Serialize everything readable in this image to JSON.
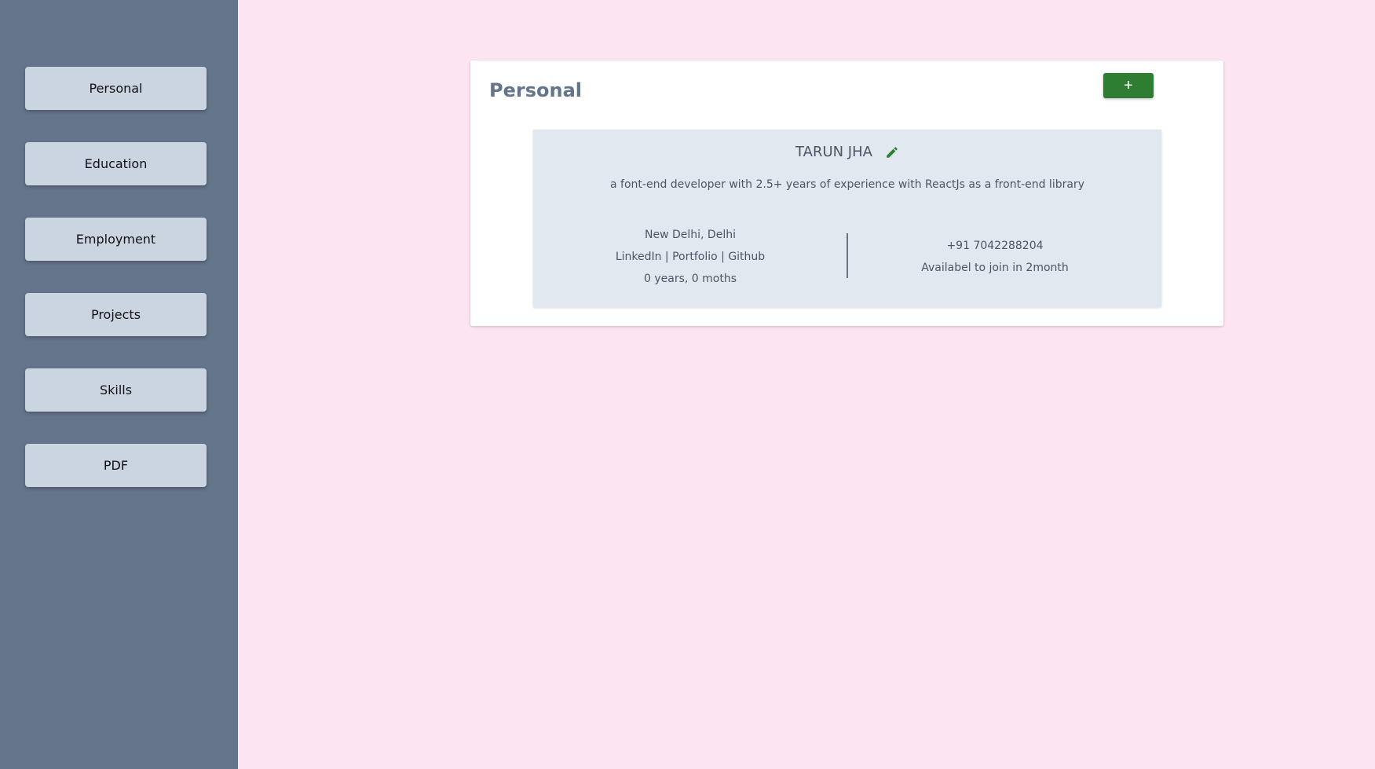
{
  "sidebar": {
    "items": [
      {
        "label": "Personal"
      },
      {
        "label": "Education"
      },
      {
        "label": "Employment"
      },
      {
        "label": "Projects"
      },
      {
        "label": "Skills"
      },
      {
        "label": "PDF"
      }
    ]
  },
  "section": {
    "title": "Personal",
    "add_label": "+"
  },
  "profile": {
    "name": "TARUN JHA",
    "summary": "a font-end developer with 2.5+ years of experience with ReactJs as a front-end library",
    "location": "New Delhi, Delhi",
    "links": "LinkedIn | Portfolio | Github",
    "experience": "0 years, 0 moths",
    "phone": "+91 7042288204",
    "availability": "Availabel to join in 2month"
  },
  "icons": {
    "edit": "pencil-icon"
  },
  "colors": {
    "background": "#fce4f1",
    "sidebar": "#64748b",
    "nav_button": "#cbd5e1",
    "accent_green": "#2e7d32",
    "panel": "#e2e8f0",
    "title": "#64748b"
  }
}
